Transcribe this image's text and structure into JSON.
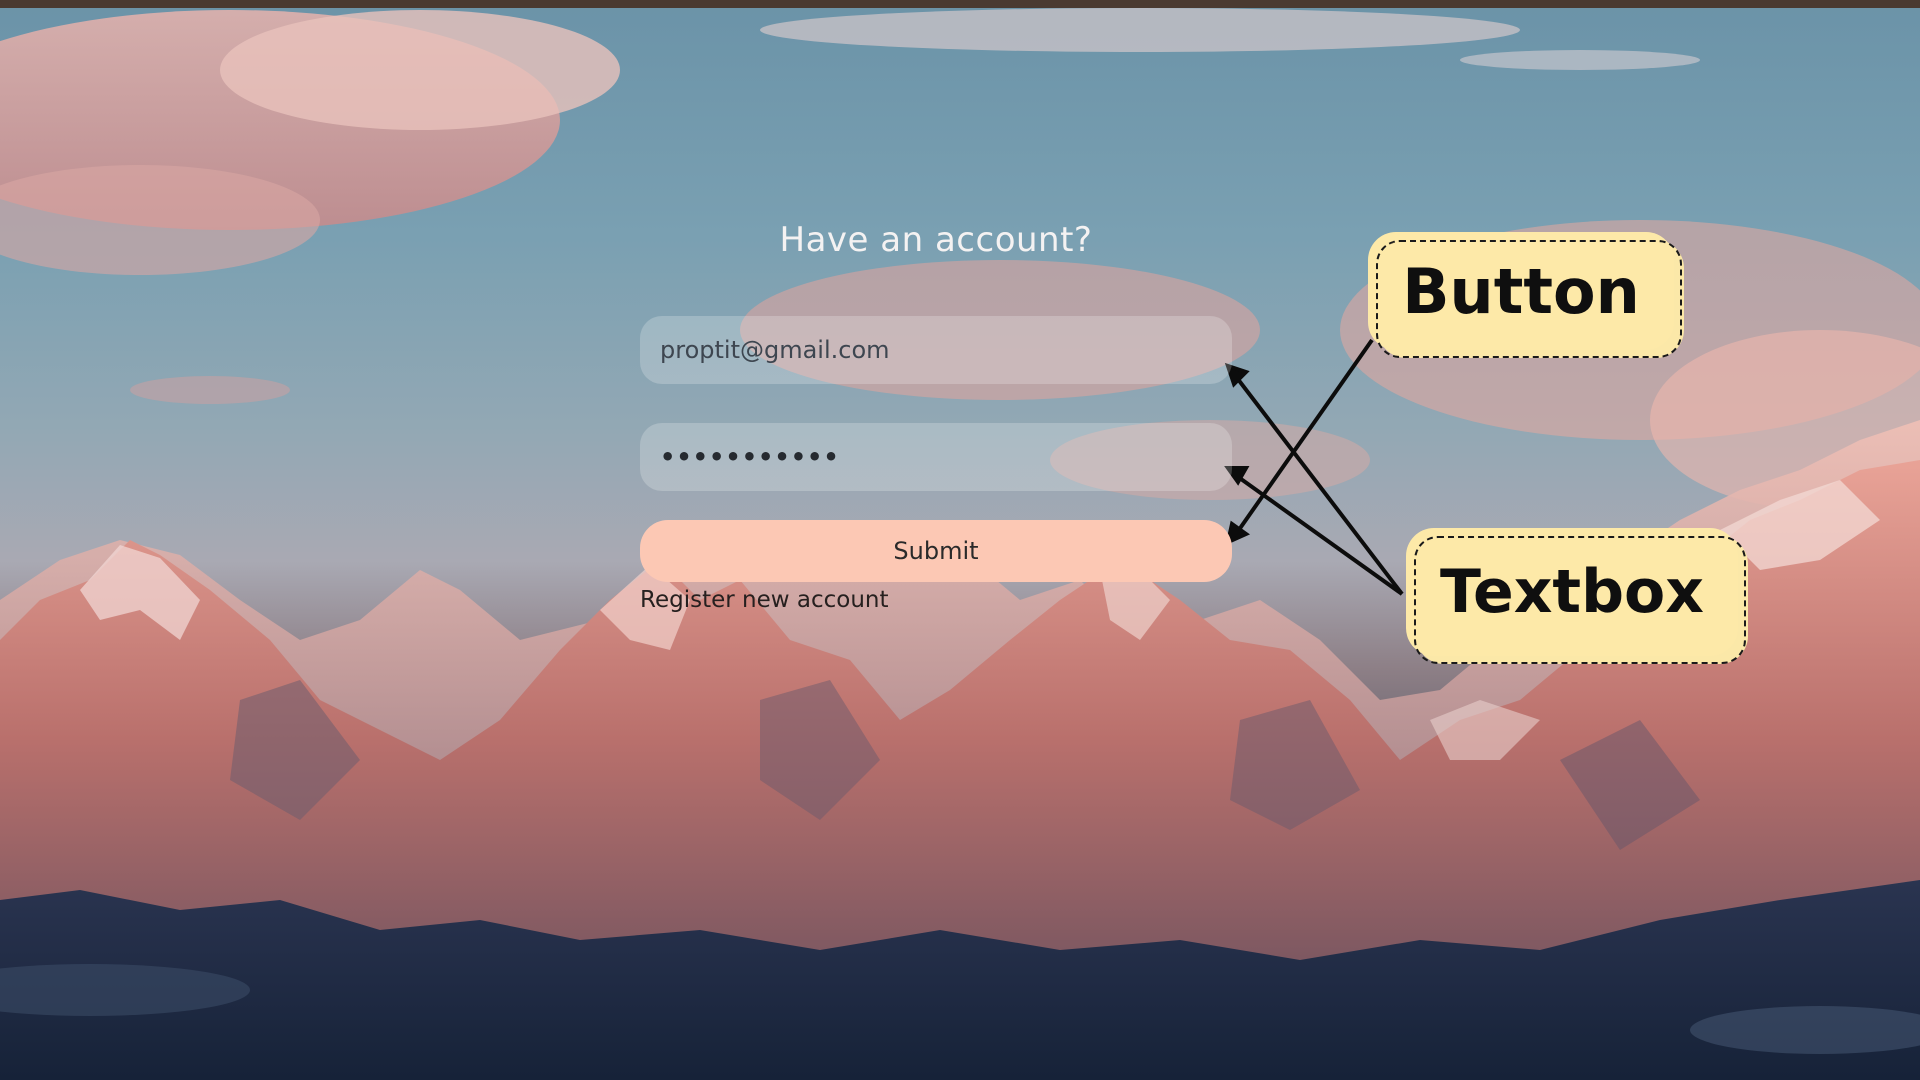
{
  "form": {
    "title": "Have an account?",
    "email_value": "proptit@gmail.com",
    "password_value": "•••••••••••",
    "submit_label": "Submit",
    "register_link": "Register new account"
  },
  "annotations": {
    "button_label": "Button",
    "textbox_label": "Textbox"
  },
  "colors": {
    "submit_bg": "#fcc8b4",
    "callout_bg": "#fde9a8",
    "top_bar": "#4a3a31"
  }
}
